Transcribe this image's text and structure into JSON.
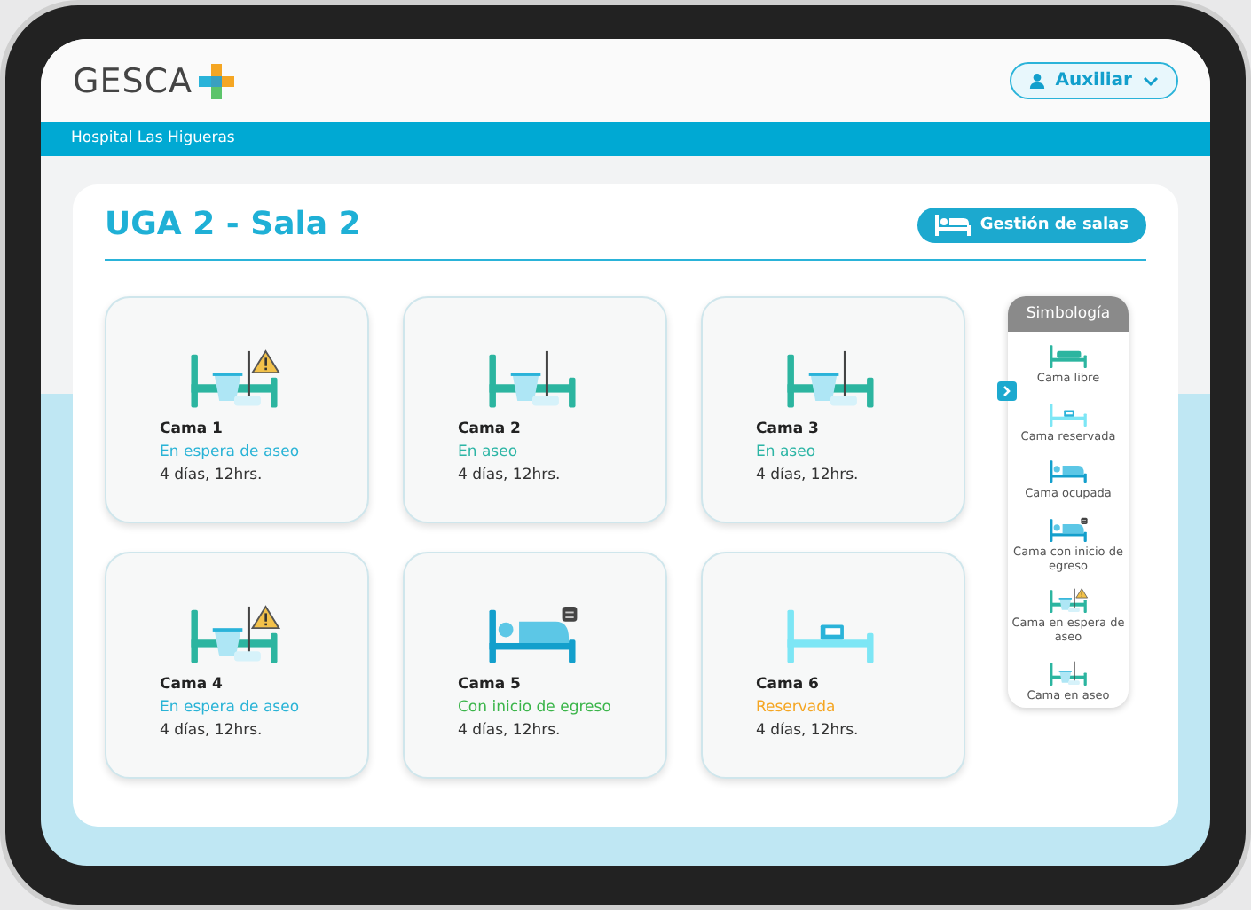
{
  "header": {
    "logo": "GESCA",
    "user_button": "Auxiliar",
    "hospital": "Hospital Las Higueras"
  },
  "room": {
    "title": "UGA 2 - Sala 2",
    "manage_button": "Gestión de salas"
  },
  "beds": [
    {
      "name": "Cama 1",
      "kind": "waiting",
      "status": "En espera de aseo",
      "color": "#29b3d6",
      "time": "4 días, 12hrs."
    },
    {
      "name": "Cama 2",
      "kind": "cleaning",
      "status": "En aseo",
      "color": "#2cb5a5",
      "time": "4 días, 12hrs."
    },
    {
      "name": "Cama 3",
      "kind": "cleaning",
      "status": "En aseo",
      "color": "#2cb5a5",
      "time": "4 días, 12hrs."
    },
    {
      "name": "Cama 4",
      "kind": "waiting",
      "status": "En espera de aseo",
      "color": "#29b3d6",
      "time": "4 días, 12hrs."
    },
    {
      "name": "Cama 5",
      "kind": "discharge",
      "status": "Con inicio de egreso",
      "color": "#3bb54a",
      "time": "4 días, 12hrs."
    },
    {
      "name": "Cama 6",
      "kind": "reserved",
      "status": "Reservada",
      "color": "#f5a623",
      "time": "4 días, 12hrs."
    }
  ],
  "legend": {
    "title": "Simbología",
    "items": [
      {
        "kind": "free",
        "label": "Cama libre"
      },
      {
        "kind": "reserved",
        "label": "Cama reservada"
      },
      {
        "kind": "occupied",
        "label": "Cama ocupada"
      },
      {
        "kind": "discharge",
        "label": "Cama con inicio de egreso"
      },
      {
        "kind": "waiting",
        "label": "Cama en espera de aseo"
      },
      {
        "kind": "cleaning",
        "label": "Cama en aseo"
      }
    ]
  }
}
